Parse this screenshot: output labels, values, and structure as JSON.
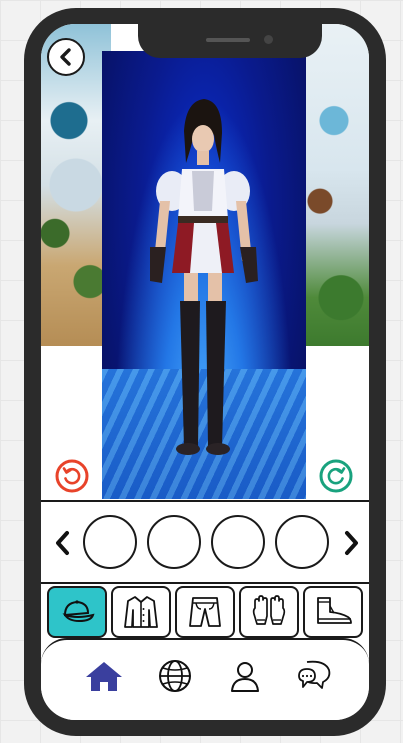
{
  "screen": {
    "background_scene": "snowy-fantasy-map",
    "stage_background": "blue-starfield-crystal-floor"
  },
  "header": {
    "back_icon": "chevron-left-icon"
  },
  "controls": {
    "undo_icon": "undo-icon",
    "redo_icon": "redo-icon",
    "undo_color": "#e8432a",
    "redo_color": "#19a27e"
  },
  "slot_row": {
    "prev_icon": "chevron-left-icon",
    "next_icon": "chevron-right-icon",
    "slots": [
      {
        "state": "empty"
      },
      {
        "state": "empty"
      },
      {
        "state": "empty"
      },
      {
        "state": "empty"
      }
    ]
  },
  "categories": [
    {
      "icon": "cap-icon",
      "active": true
    },
    {
      "icon": "jacket-icon",
      "active": false
    },
    {
      "icon": "shorts-icon",
      "active": false
    },
    {
      "icon": "gloves-icon",
      "active": false
    },
    {
      "icon": "boot-icon",
      "active": false
    }
  ],
  "nav": {
    "items": [
      {
        "icon": "home-icon",
        "active": true
      },
      {
        "icon": "globe-icon",
        "active": false
      },
      {
        "icon": "user-icon",
        "active": false
      },
      {
        "icon": "chat-icon",
        "active": false
      }
    ],
    "active_color": "#3a3f9e"
  },
  "colors": {
    "accent": "#2ec4c9",
    "frame": "#2b2b2b"
  }
}
